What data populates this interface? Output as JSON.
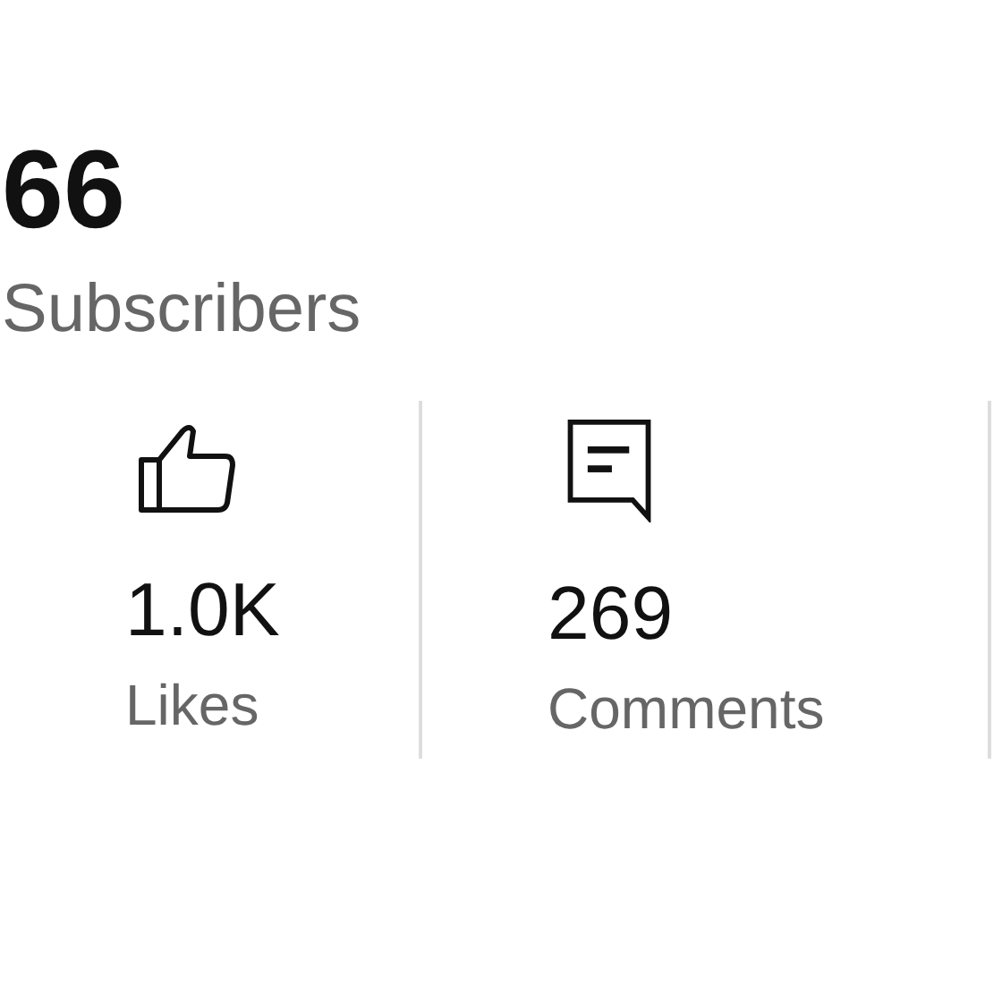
{
  "subscribers": {
    "count": "66",
    "label": "Subscribers"
  },
  "stats": [
    {
      "kind": "likes",
      "value": "1.0K",
      "label": "Likes"
    },
    {
      "kind": "comments",
      "value": "269",
      "label": "Comments"
    }
  ]
}
